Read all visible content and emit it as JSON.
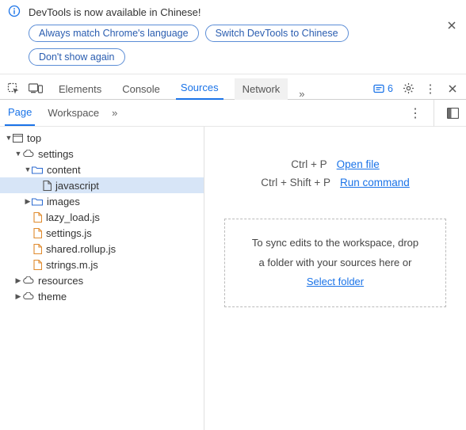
{
  "banner": {
    "title": "DevTools is now available in Chinese!",
    "buttons": {
      "match_lang": "Always match Chrome's language",
      "switch": "Switch DevTools to Chinese",
      "dont_show": "Don't show again"
    }
  },
  "toolbar": {
    "tabs": {
      "elements": "Elements",
      "console": "Console",
      "sources": "Sources",
      "network": "Network"
    },
    "more_chevron": "»",
    "issues_count": "6",
    "settings_icon": "gear-icon",
    "more_icon": "kebab-icon",
    "close_icon": "close-icon"
  },
  "sources_subbar": {
    "tabs": {
      "page": "Page",
      "workspace": "Workspace"
    },
    "more_chevron": "»"
  },
  "tree": {
    "top": "top",
    "settings": "settings",
    "content": "content",
    "javascript": "javascript",
    "images": "images",
    "files": {
      "lazy_load": "lazy_load.js",
      "settings": "settings.js",
      "shared_rollup": "shared.rollup.js",
      "strings": "strings.m.js"
    },
    "resources": "resources",
    "theme": "theme"
  },
  "right": {
    "shortcut_open": "Ctrl + P",
    "open_file": "Open file",
    "shortcut_run": "Ctrl + Shift + P",
    "run_command": "Run command",
    "drop_l1": "To sync edits to the workspace, drop",
    "drop_l2": "a folder with your sources here or",
    "select_folder": "Select folder"
  }
}
